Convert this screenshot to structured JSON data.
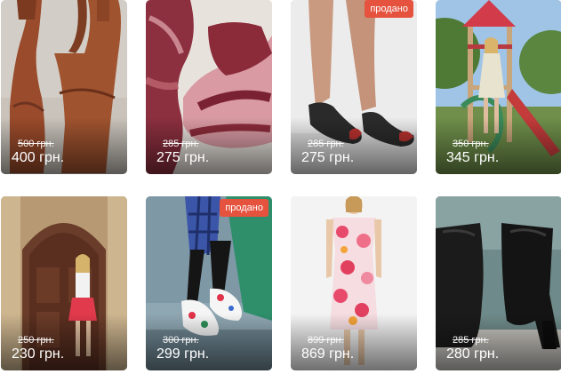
{
  "products": [
    {
      "old_price": "500 грн.",
      "price": "400 грн.",
      "sold": "",
      "image": "brown-suede-heels"
    },
    {
      "old_price": "285 грн.",
      "price": "275 грн.",
      "sold": "",
      "image": "burgundy-high-top-sneakers"
    },
    {
      "old_price": "285 грн.",
      "price": "275 грн.",
      "sold": "продано",
      "image": "black-flats-with-red-trim"
    },
    {
      "old_price": "350 грн.",
      "price": "345 грн.",
      "sold": "",
      "image": "girl-on-playground"
    },
    {
      "old_price": "250 грн.",
      "price": "230 грн.",
      "sold": "",
      "image": "girl-in-red-skirt-by-door"
    },
    {
      "old_price": "300 грн.",
      "price": "299 грн.",
      "sold": "продано",
      "image": "floral-sneakers-plaid-shirt"
    },
    {
      "old_price": "899 грн.",
      "price": "869 грн.",
      "sold": "",
      "image": "floral-midi-dress"
    },
    {
      "old_price": "285 грн.",
      "price": "280 грн.",
      "sold": "",
      "image": "black-leather-ankle-boots"
    }
  ],
  "colors": {
    "sold_badge": "#e5533f",
    "price_text": "#ffffff"
  }
}
